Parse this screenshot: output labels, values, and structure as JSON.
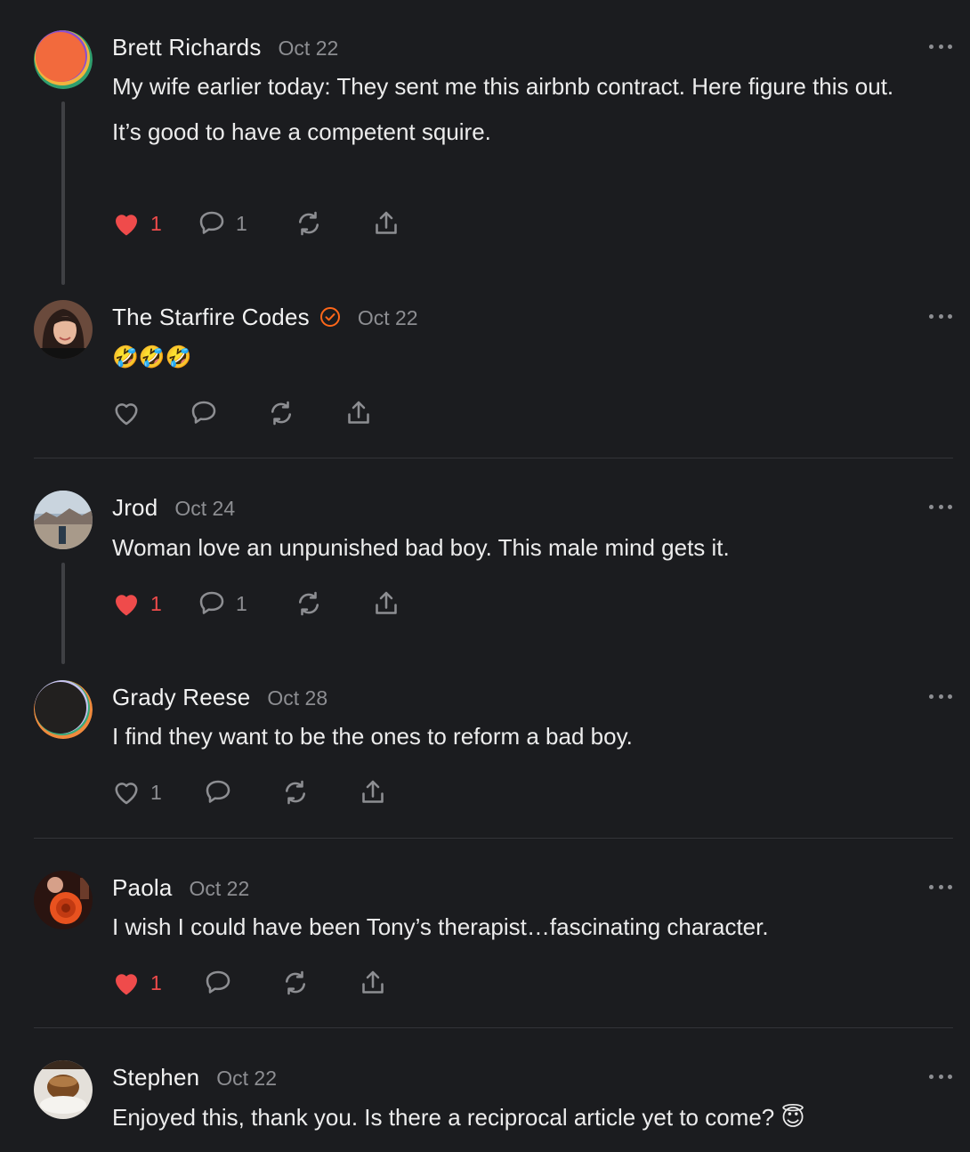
{
  "comments": [
    {
      "name": "Brett Richards",
      "date": "Oct 22",
      "lines": [
        "My wife earlier today: They sent me this airbnb contract. Here figure this out.",
        "It’s good to have a competent squire."
      ],
      "likes": "1",
      "replies": "1",
      "liked": true,
      "avatar": "orange-circle-avatar"
    },
    {
      "name": "The Starfire Codes",
      "date": "Oct 22",
      "verified": true,
      "lines": [
        "🤣🤣🤣"
      ],
      "likes": "",
      "replies": "",
      "liked": false,
      "avatar": "photo-avatar-woman"
    },
    {
      "name": "Jrod",
      "date": "Oct 24",
      "lines": [
        "Woman love an unpunished bad boy. This male mind gets it."
      ],
      "likes": "1",
      "replies": "1",
      "liked": true,
      "avatar": "photo-avatar-landscape"
    },
    {
      "name": "Grady Reese",
      "date": "Oct 28",
      "lines": [
        "I find they want to be the ones to reform a bad boy."
      ],
      "likes": "1",
      "replies": "",
      "liked": false,
      "avatar": "dark-circle-avatar"
    },
    {
      "name": "Paola",
      "date": "Oct 22",
      "lines": [
        "I wish I could have been Tony’s therapist…fascinating character."
      ],
      "likes": "1",
      "replies": "",
      "liked": true,
      "avatar": "photo-avatar-rose"
    },
    {
      "name": "Stephen",
      "date": "Oct 22",
      "lines": [
        "Enjoyed this, thank you. Is there a reciprocal article yet to come? 😇"
      ],
      "avatar": "photo-avatar-coffee"
    }
  ],
  "colors": {
    "background": "#1b1c1f",
    "like_red": "#ef4b4b",
    "verified_orange": "#ff6719",
    "muted": "#8d8e92"
  },
  "icons": [
    "heart-icon",
    "comment-icon",
    "restack-icon",
    "share-icon",
    "more-icon",
    "verified-badge-icon"
  ]
}
